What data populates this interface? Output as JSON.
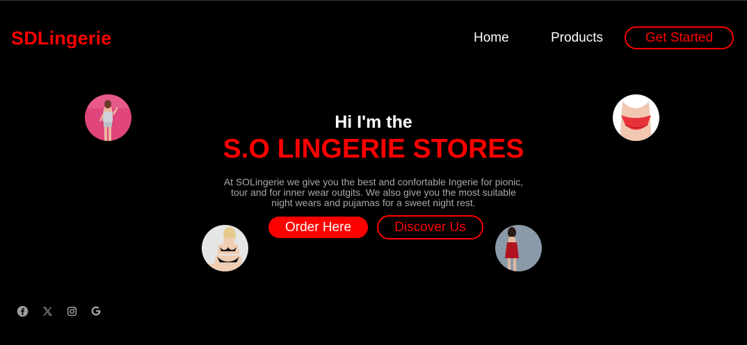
{
  "header": {
    "logo": "SDLingerie",
    "nav": {
      "home": "Home",
      "products": "Products"
    },
    "cta": "Get Started"
  },
  "hero": {
    "intro": "Hi I'm the",
    "title": "S.O LINGERIE STORES",
    "description": "At SOLingerie we give you the best and confortable Ingerie for pionic, tour and for inner wear outgits. We also give you the most suitable night wears and pujamas for a sweet night rest.",
    "order_button": "Order Here",
    "discover_button": "Discover Us"
  },
  "images": [
    "model-photo-pink-background",
    "red-underwear-photo",
    "model-photo-black-lingerie",
    "model-photo-red-dress"
  ],
  "social": [
    "facebook-icon",
    "x-icon",
    "instagram-icon",
    "google-icon"
  ],
  "colors": {
    "accent": "#ff0000",
    "background": "#000000",
    "text": "#ffffff",
    "muted_text": "#a9a9a9"
  }
}
